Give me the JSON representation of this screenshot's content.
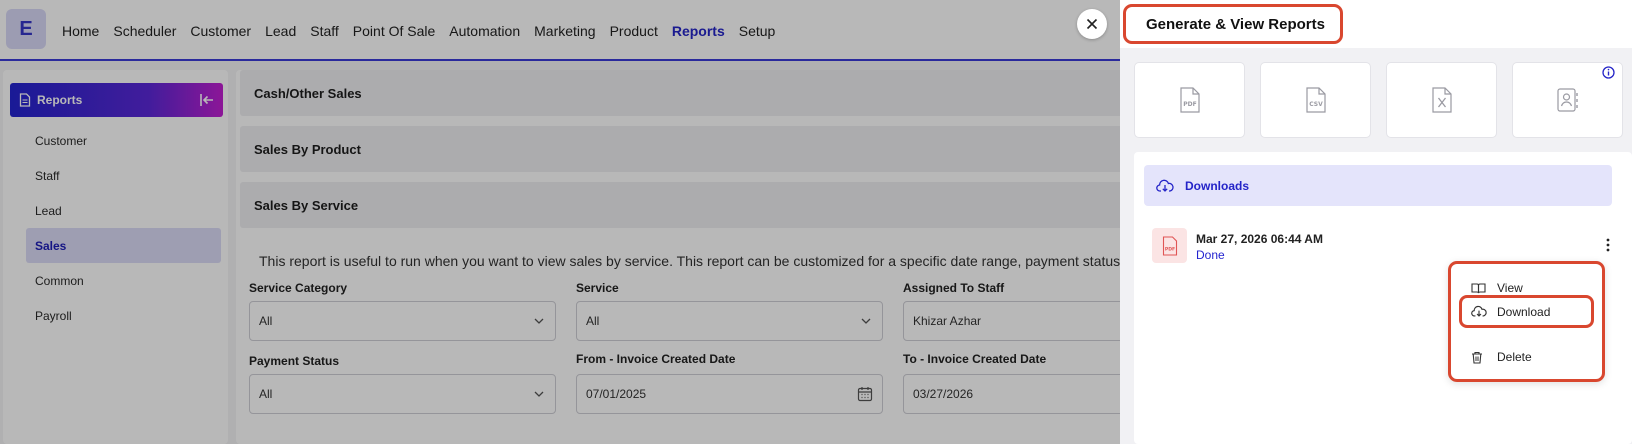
{
  "nav": {
    "logo_letter": "E",
    "links": [
      "Home",
      "Scheduler",
      "Customer",
      "Lead",
      "Staff",
      "Point Of Sale",
      "Automation",
      "Marketing",
      "Product",
      "Reports",
      "Setup"
    ],
    "active": "Reports"
  },
  "sidebar": {
    "header": "Reports",
    "items": [
      "Customer",
      "Staff",
      "Lead",
      "Sales",
      "Common",
      "Payroll"
    ],
    "active": "Sales"
  },
  "content": {
    "sections": [
      "Cash/Other Sales",
      "Sales By Product",
      "Sales By Service"
    ],
    "description": "This report is useful to run when you want to view sales by service. This report can be customized for a specific date range, payment status, cu",
    "fields": {
      "service_category": {
        "label": "Service Category",
        "value": "All"
      },
      "service": {
        "label": "Service",
        "value": "All"
      },
      "assigned_staff": {
        "label": "Assigned To Staff",
        "value": "Khizar Azhar"
      },
      "payment_status": {
        "label": "Payment Status",
        "value": "All"
      },
      "from_date": {
        "label": "From - Invoice Created Date",
        "value": "07/01/2025"
      },
      "to_date": {
        "label": "To - Invoice Created Date",
        "value": "03/27/2026"
      }
    }
  },
  "panel": {
    "title": "Generate & View Reports",
    "formats": [
      "pdf-icon",
      "csv-icon",
      "xls-icon",
      "contact-report-icon"
    ],
    "downloads_label": "Downloads",
    "item": {
      "date": "Mar 27, 2026 06:44 AM",
      "status": "Done"
    },
    "menu": {
      "view": "View",
      "download": "Download",
      "delete": "Delete"
    }
  },
  "colors": {
    "brand": "#2626c8",
    "highlight": "#d9472f",
    "status_done": "#2424d0"
  }
}
